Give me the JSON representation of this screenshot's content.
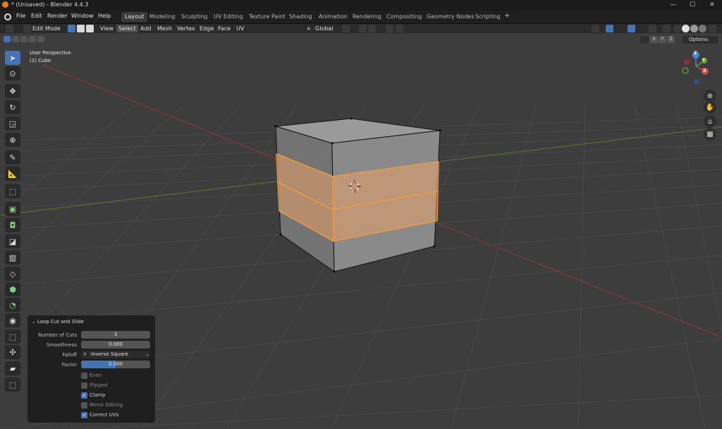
{
  "window": {
    "title": "* (Unsaved) - Blender 4.4.3",
    "controls": [
      "—",
      "☐",
      "✕"
    ]
  },
  "menu": [
    "File",
    "Edit",
    "Render",
    "Window",
    "Help"
  ],
  "workspaces": [
    "Layout",
    "Modeling",
    "Sculpting",
    "UV Editing",
    "Texture Paint",
    "Shading",
    "Animation",
    "Rendering",
    "Compositing",
    "Geometry Nodes",
    "Scripting"
  ],
  "workspace_add": "+",
  "header": {
    "mode": "Edit Mode",
    "menus": [
      "View",
      "Select",
      "Add",
      "Mesh",
      "Vertex",
      "Edge",
      "Face",
      "UV"
    ],
    "transform_orientation": "Global"
  },
  "row2": {
    "axis_x": "X",
    "axis_y": "Y",
    "axis_z": "Z",
    "options": "Options"
  },
  "viewport": {
    "perspective": "User Perspective",
    "object": "(1) Cube"
  },
  "gizmo": {
    "x": "X",
    "y": "Y",
    "z": "Z"
  },
  "operator": {
    "title": "Loop Cut and Slide",
    "number_of_cuts_label": "Number of Cuts",
    "number_of_cuts": "3",
    "smoothness_label": "Smoothness",
    "smoothness": "0.000",
    "falloff_label": "Falloff",
    "falloff": "Inverse Square",
    "factor_label": "Factor",
    "factor": "0.000",
    "even": "Even",
    "flipped": "Flipped",
    "clamp": "Clamp",
    "mirror_editing": "Mirror Editing",
    "correct_uvs": "Correct UVs"
  },
  "colors": {
    "accent": "#4772b3",
    "selection": "#f39c3a",
    "viewport_bg": "#3d3d3d"
  }
}
